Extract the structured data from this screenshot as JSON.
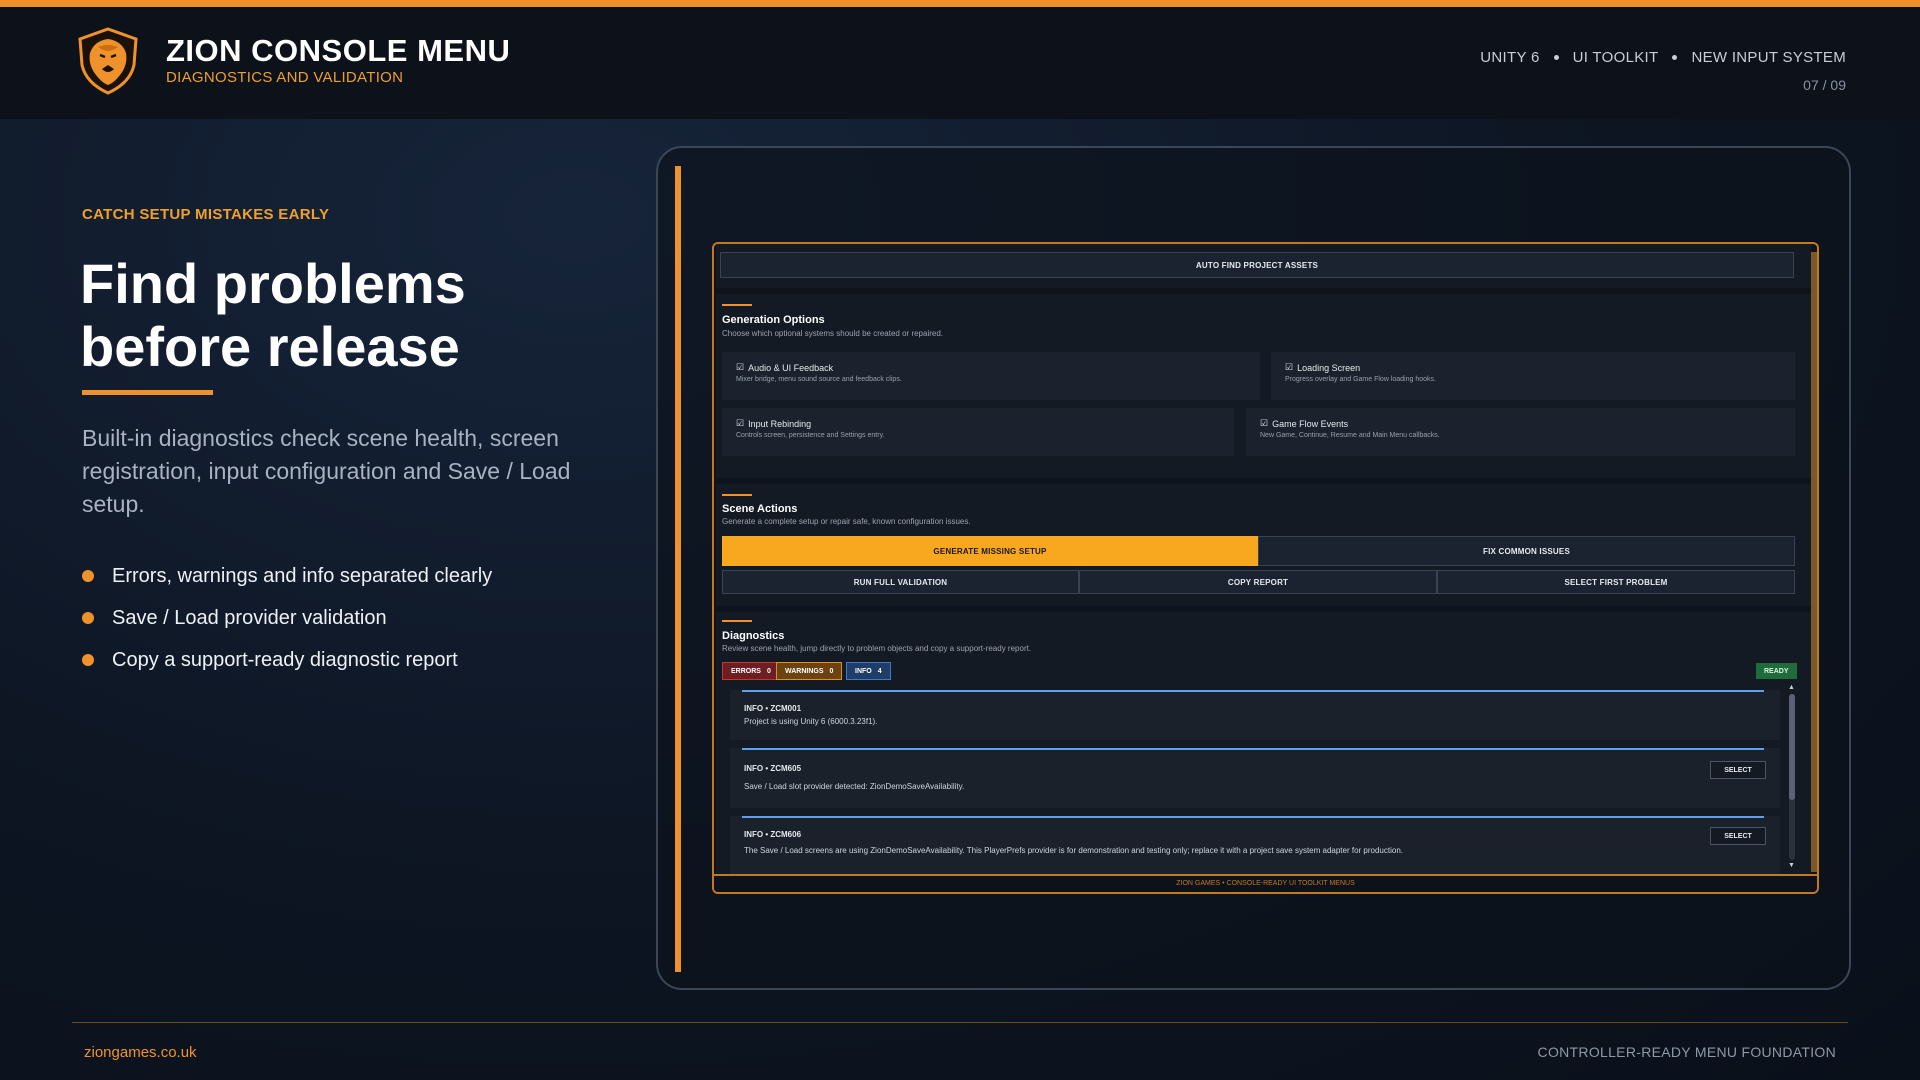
{
  "header": {
    "title": "ZION CONSOLE MENU",
    "subtitle": "DIAGNOSTICS AND VALIDATION",
    "tech": [
      "UNITY 6",
      "UI TOOLKIT",
      "NEW INPUT SYSTEM"
    ],
    "page": "07 / 09",
    "logo_icon": "lion-shield-icon"
  },
  "hero": {
    "eyebrow": "CATCH SETUP MISTAKES EARLY",
    "headline_1": "Find problems",
    "headline_2": "before release",
    "description": "Built-in diagnostics check scene health, screen registration, input configuration and Save / Load setup.",
    "bullets": [
      "Errors, warnings and info separated clearly",
      "Save / Load provider validation",
      "Copy a support-ready diagnostic report"
    ]
  },
  "screen": {
    "auto_find": "AUTO FIND PROJECT ASSETS",
    "generation": {
      "title": "Generation Options",
      "subtitle": "Choose which optional systems should be created or repaired.",
      "options": [
        {
          "title": "Audio & UI Feedback",
          "desc": "Mixer bridge, menu sound source and feedback clips.",
          "checked": true
        },
        {
          "title": "Loading Screen",
          "desc": "Progress overlay and Game Flow loading hooks.",
          "checked": true
        },
        {
          "title": "Input Rebinding",
          "desc": "Controls screen, persistence and Settings entry.",
          "checked": true
        },
        {
          "title": "Game Flow Events",
          "desc": "New Game, Continue, Resume and Main Menu callbacks.",
          "checked": true
        }
      ]
    },
    "scene_actions": {
      "title": "Scene Actions",
      "subtitle": "Generate a complete setup or repair safe, known configuration issues.",
      "generate": "GENERATE MISSING SETUP",
      "fix": "FIX COMMON ISSUES",
      "run": "RUN FULL VALIDATION",
      "copy": "COPY REPORT",
      "select_first": "SELECT FIRST PROBLEM"
    },
    "diagnostics": {
      "title": "Diagnostics",
      "subtitle": "Review scene health, jump directly to problem objects and copy a support-ready report.",
      "errors_label": "ERRORS",
      "errors_count": "0",
      "warnings_label": "WARNINGS",
      "warnings_count": "0",
      "info_label": "INFO",
      "info_count": "4",
      "status": "READY",
      "select_label": "SELECT",
      "entries": [
        {
          "head": "INFO  •  ZCM001",
          "msg": "Project is using Unity 6 (6000.3.23f1)."
        },
        {
          "head": "INFO  •  ZCM605",
          "msg": "Save / Load slot provider detected: ZionDemoSaveAvailability."
        },
        {
          "head": "INFO  •  ZCM606",
          "msg": "The Save / Load screens are using ZionDemoSaveAvailability. This PlayerPrefs provider is for demonstration and testing only; replace it with a project save system adapter for production."
        }
      ]
    },
    "footer": "ZION GAMES  •  CONSOLE-READY UI TOOLKIT MENUS"
  },
  "footer": {
    "left": "ziongames.co.uk",
    "right": "CONTROLLER-READY MENU FOUNDATION"
  },
  "colors": {
    "accent": "#f0922b",
    "primary_button": "#f7a81f",
    "info": "#5ea1f0",
    "ready": "#1f6b3c"
  }
}
